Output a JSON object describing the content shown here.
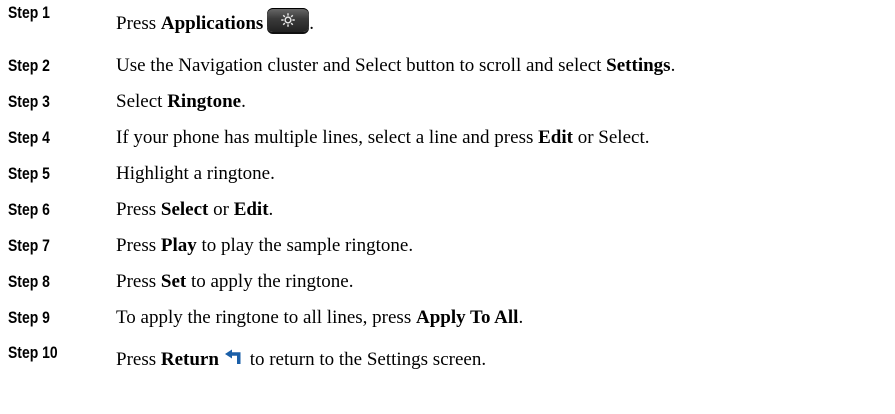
{
  "steps": [
    {
      "label": "Step 1",
      "parts": [
        "Press ",
        "Applications",
        "."
      ]
    },
    {
      "label": "Step 2",
      "parts": [
        "Use the Navigation cluster and Select button to scroll and select ",
        "Settings",
        "."
      ]
    },
    {
      "label": "Step 3",
      "parts": [
        "Select ",
        "Ringtone",
        "."
      ]
    },
    {
      "label": "Step 4",
      "parts": [
        "If your phone has multiple lines, select a line and press ",
        "Edit",
        " or Select."
      ]
    },
    {
      "label": "Step 5",
      "parts": [
        "Highlight a ringtone."
      ]
    },
    {
      "label": "Step 6",
      "parts": [
        "Press ",
        "Select",
        " or ",
        "Edit",
        "."
      ]
    },
    {
      "label": "Step 7",
      "parts": [
        "Press ",
        "Play",
        " to play the sample ringtone."
      ]
    },
    {
      "label": "Step 8",
      "parts": [
        "Press ",
        "Set",
        " to apply the ringtone."
      ]
    },
    {
      "label": "Step 9",
      "parts": [
        "To apply the ringtone to all lines, press ",
        "Apply To All",
        "."
      ]
    },
    {
      "label": "Step 10",
      "parts": [
        "Press ",
        "Return",
        " to return to the Settings screen."
      ]
    }
  ],
  "icons": {
    "applications": "gear-icon",
    "return": "return-arrow-icon"
  },
  "colors": {
    "text": "#000000",
    "applications_button": "#3a3a3a",
    "return_icon": "#1a5fa8"
  }
}
